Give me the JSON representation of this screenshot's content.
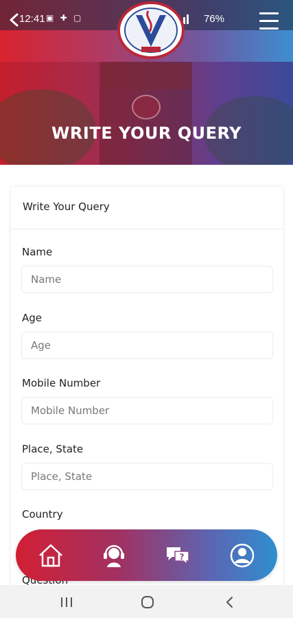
{
  "status_bar": {
    "time": "12:41",
    "battery": "76%"
  },
  "banner": {
    "title": "WRITE YOUR QUERY"
  },
  "form": {
    "card_title": "Write Your Query",
    "fields": [
      {
        "label": "Name",
        "placeholder": "Name"
      },
      {
        "label": "Age",
        "placeholder": "Age"
      },
      {
        "label": "Mobile Number",
        "placeholder": "Mobile Number"
      },
      {
        "label": "Place, State",
        "placeholder": "Place, State"
      },
      {
        "label": "Country",
        "placeholder": ""
      }
    ],
    "partial_label": "Question"
  },
  "bottom_nav": {
    "items": [
      {
        "icon": "home-icon"
      },
      {
        "icon": "support-agent-icon"
      },
      {
        "icon": "faq-chat-icon"
      },
      {
        "icon": "profile-icon"
      }
    ]
  },
  "colors": {
    "gradient_start": "#d8232f",
    "gradient_end": "#3d8ed0"
  }
}
